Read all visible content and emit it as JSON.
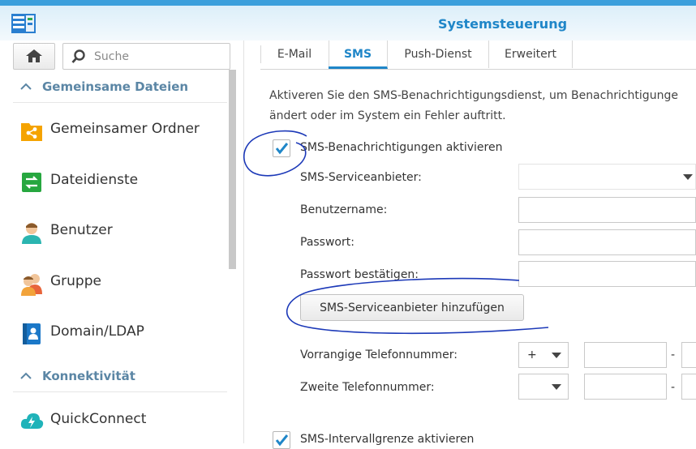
{
  "window": {
    "title": "Systemsteuerung"
  },
  "sidebar": {
    "search_placeholder": "Suche",
    "sections": [
      {
        "label": "Gemeinsame Dateien"
      },
      {
        "label": "Konnektivität"
      }
    ],
    "items": [
      {
        "label": "Gemeinsamer Ordner",
        "icon": "shared-folder-icon"
      },
      {
        "label": "Dateidienste",
        "icon": "file-services-icon"
      },
      {
        "label": "Benutzer",
        "icon": "user-icon"
      },
      {
        "label": "Gruppe",
        "icon": "group-icon"
      },
      {
        "label": "Domain/LDAP",
        "icon": "domain-ldap-icon"
      },
      {
        "label": "QuickConnect",
        "icon": "quickconnect-icon"
      }
    ]
  },
  "tabs": [
    {
      "label": "E-Mail"
    },
    {
      "label": "SMS"
    },
    {
      "label": "Push-Dienst"
    },
    {
      "label": "Erweitert"
    }
  ],
  "sms": {
    "description_line1": "Aktiveren Sie den SMS-Benachrichtigungsdienst, um Benachrichtigunge",
    "description_line2": "ändert oder im System ein Fehler auftritt.",
    "enable_label": "SMS-Benachrichtigungen aktivieren",
    "enable_checked": true,
    "provider_label": "SMS-Serviceanbieter:",
    "username_label": "Benutzername:",
    "password_label": "Passwort:",
    "password_confirm_label": "Passwort bestätigen:",
    "add_provider_button": "SMS-Serviceanbieter hinzufügen",
    "primary_phone_label": "Vorrangige Telefonnummer:",
    "primary_phone_prefix": "+",
    "secondary_phone_label": "Zweite Telefonnummer:",
    "dash": "-",
    "interval_label": "SMS-Intervallgrenze aktivieren",
    "interval_checked": true
  },
  "colors": {
    "accent": "#1f86c8",
    "annotation": "#1c39b8",
    "section": "#5b86a5"
  }
}
